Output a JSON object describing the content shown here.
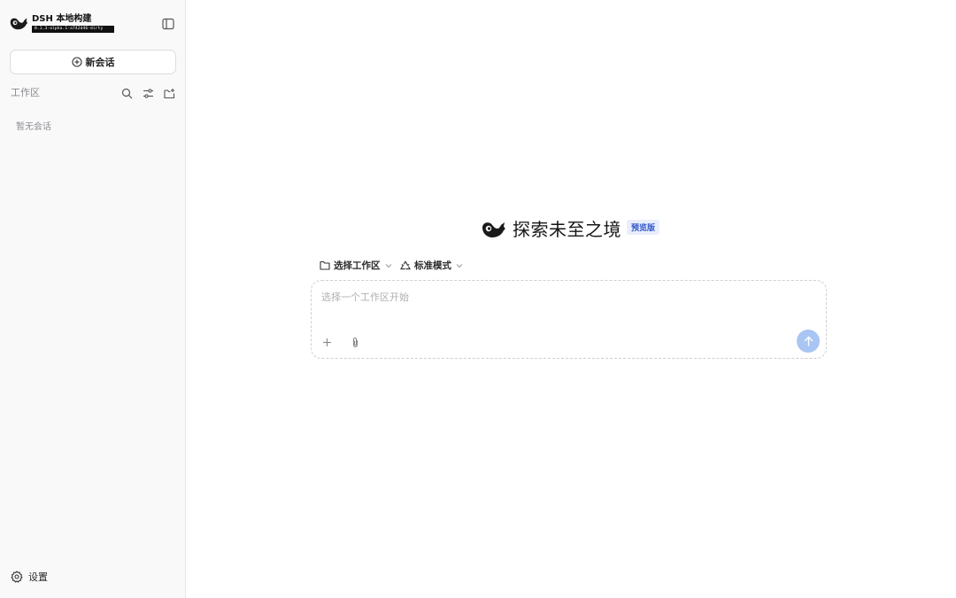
{
  "sidebar": {
    "brand_name": "DSH 本地构建",
    "brand_version": "0.1.3-alpha.1-a742d46-dirty",
    "new_chat_label": "新会话",
    "workspace_label": "工作区",
    "empty_text": "暂无会话",
    "settings_label": "设置"
  },
  "main": {
    "title": "探索未至之境",
    "badge": "预览版",
    "workspace_selector": "选择工作区",
    "mode_selector": "标准模式",
    "input_placeholder": "选择一个工作区开始"
  },
  "icons": {
    "logo": "whale-logo-icon",
    "sidebar_toggle": "sidebar-toggle-icon",
    "new_chat": "plus-circle-icon",
    "search": "search-icon",
    "filter": "sliders-icon",
    "add_folder": "folder-plus-icon",
    "settings": "gear-icon",
    "folder": "folder-icon",
    "mode": "recycle-icon",
    "attach": "paperclip-icon",
    "add": "plus-icon",
    "send": "arrow-up-icon"
  },
  "colors": {
    "send_button": "#a9c5f3",
    "badge_bg": "#e8eefc",
    "badge_text": "#2f55c9"
  }
}
